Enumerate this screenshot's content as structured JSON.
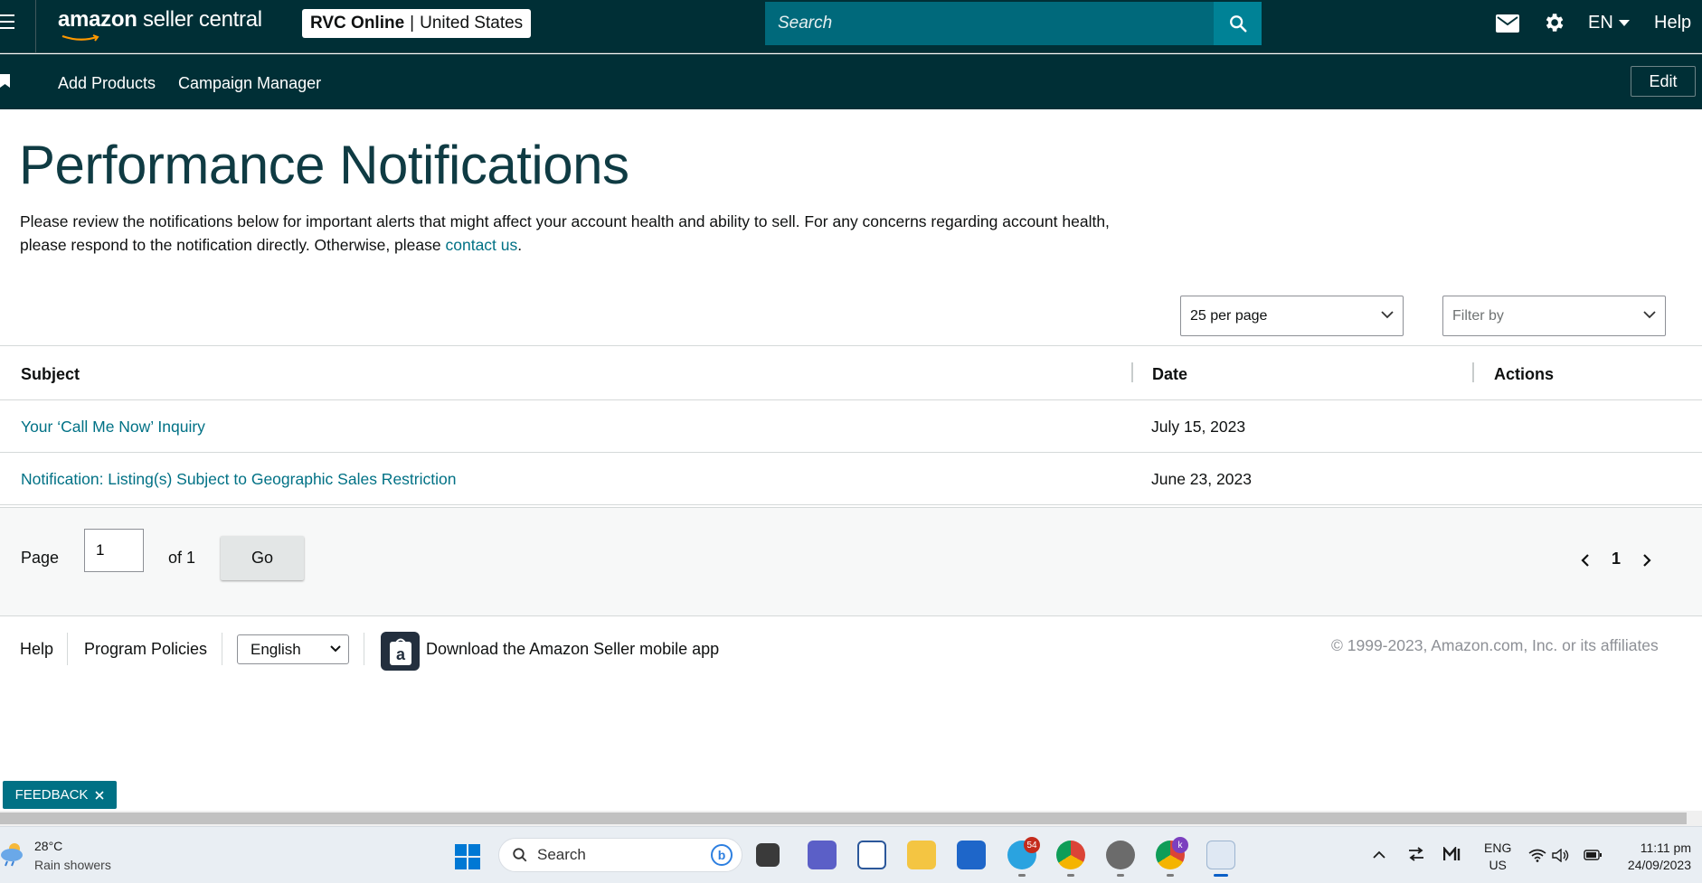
{
  "header": {
    "logo_word1": "amazon",
    "logo_word2": "seller central",
    "store_name": "RVC Online",
    "store_separator": "|",
    "store_region": "United States",
    "search_placeholder": "Search",
    "language": "EN",
    "help": "Help"
  },
  "subnav": {
    "items": [
      "Add Products",
      "Campaign Manager"
    ],
    "edit": "Edit"
  },
  "main": {
    "title": "Performance Notifications",
    "intro_text": "Please review the notifications below for important alerts that might affect your account health and ability to sell. For any concerns regarding account health, please respond to the notification directly. Otherwise, please ",
    "intro_link": "contact us",
    "intro_end": ".",
    "per_page": "25 per page",
    "filter_placeholder": "Filter by"
  },
  "table": {
    "columns": [
      "Subject",
      "Date",
      "Actions"
    ],
    "rows": [
      {
        "subject": "Your ‘Call Me Now’ Inquiry",
        "date": "July 15, 2023"
      },
      {
        "subject": "Notification: Listing(s) Subject to Geographic Sales Restriction",
        "date": "June 23, 2023"
      }
    ]
  },
  "pager": {
    "page_label": "Page",
    "page_value": "1",
    "of_label": "of 1",
    "go": "Go",
    "current_page": "1"
  },
  "footer": {
    "help": "Help",
    "policies": "Program Policies",
    "language_selected": "English",
    "app_download": "Download the Amazon Seller mobile app",
    "copyright": "© 1999-2023, Amazon.com, Inc. or its affiliates",
    "feedback": "FEEDBACK"
  },
  "taskbar": {
    "temperature": "28°C",
    "weather": "Rain showers",
    "search": "Search",
    "telegram_badge": "54",
    "chrome_badge": "k",
    "lang_top": "ENG",
    "lang_bottom": "US",
    "time": "11:11 pm",
    "date": "24/09/2023"
  },
  "colors": {
    "header_bg": "#002f36",
    "search_bg": "#00697b",
    "link": "#007185",
    "title": "#0f3b43"
  },
  "icons": [
    "hamburger-icon",
    "search-icon",
    "mail-icon",
    "gear-icon",
    "caret-down-icon",
    "bookmark-icon",
    "chevron-down-icon",
    "chevron-left-icon",
    "chevron-right-icon",
    "close-icon",
    "amazon-app-icon",
    "weather-icon",
    "windows-start-icon"
  ]
}
